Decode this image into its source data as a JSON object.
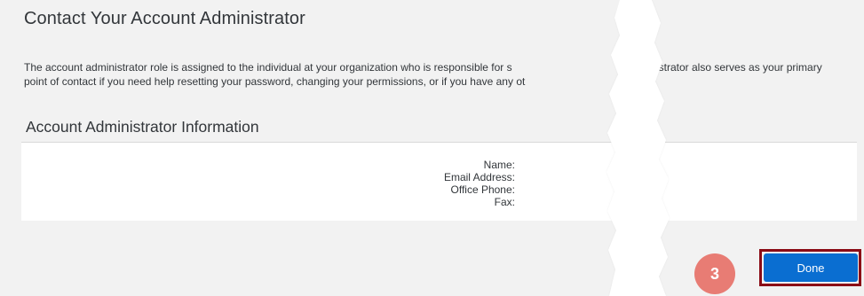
{
  "dialog": {
    "title": "Contact Your Account Administrator",
    "description_line1_left": "The account administrator role is assigned to the individual at your organization who is responsible for s",
    "description_line1_right": "istrator also serves as your primary",
    "description_line2": "point of contact if you need help resetting your password, changing your permissions, or if you have any ot",
    "section_title": "Account Administrator Information",
    "fields": {
      "name_label": "Name:",
      "email_label": "Email Address:",
      "phone_label": "Office Phone:",
      "fax_label": "Fax:"
    },
    "step_badge": "3",
    "done_label": "Done"
  },
  "colors": {
    "primary_button": "#0a6ed1",
    "highlight_border": "#8b0b16",
    "step_badge": "#e87c74",
    "panel_background": "#f2f2f2"
  }
}
